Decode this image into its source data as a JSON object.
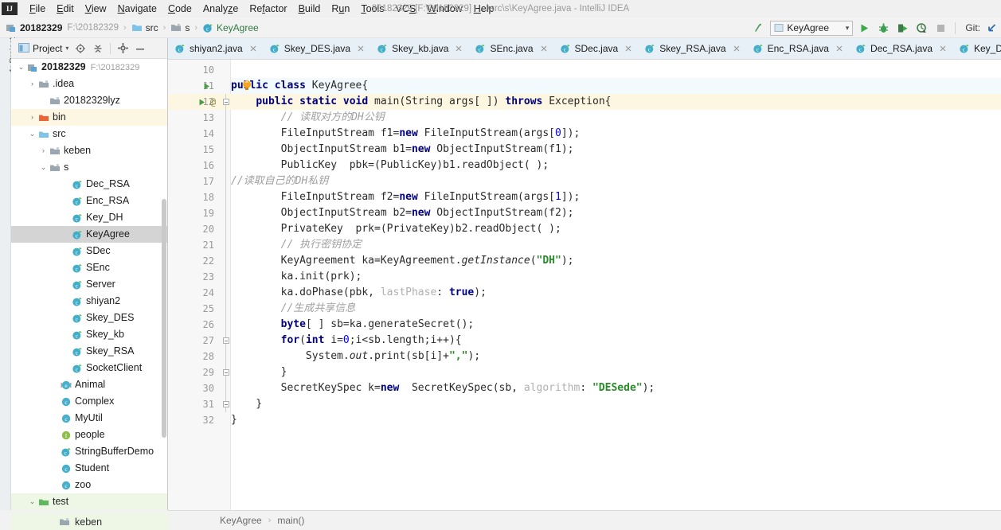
{
  "window": {
    "title": "20182329 [F:\\20182329] - ...\\src\\s\\KeyAgree.java - IntelliJ IDEA",
    "logo": "IJ"
  },
  "menu": {
    "items": [
      "File",
      "Edit",
      "View",
      "Navigate",
      "Code",
      "Analyze",
      "Refactor",
      "Build",
      "Run",
      "Tools",
      "VCS",
      "Window",
      "Help"
    ]
  },
  "breadcrumb": {
    "project": "20182329",
    "project_path": "F:\\20182329",
    "items": [
      "src",
      "s",
      "KeyAgree"
    ]
  },
  "toolbar": {
    "run_config": "KeyAgree",
    "git_label": "Git:",
    "icons": [
      "build-icon",
      "run-icon",
      "debug-icon",
      "run-coverage-icon",
      "profile-icon",
      "stop-icon",
      "vcs-update-icon"
    ]
  },
  "left_strip": {
    "tab_label": "1: Project"
  },
  "project_panel": {
    "title": "Project",
    "header_icons": [
      "locate-icon",
      "collapse-all-icon",
      "settings-icon",
      "hide-icon"
    ],
    "tree": [
      {
        "depth": 0,
        "arrow": "down",
        "icon": "module-icon",
        "label": "20182329",
        "path": "F:\\20182329",
        "bold": true,
        "style": "plain"
      },
      {
        "depth": 1,
        "arrow": "right",
        "icon": "folder-gray-icon",
        "label": ".idea",
        "style": "plain"
      },
      {
        "depth": 2,
        "arrow": "none",
        "icon": "folder-gray-icon",
        "label": "20182329lyz",
        "style": "plain"
      },
      {
        "depth": 1,
        "arrow": "right",
        "icon": "folder-orange-icon",
        "label": "bin",
        "style": "yellow"
      },
      {
        "depth": 1,
        "arrow": "down",
        "icon": "folder-blue-icon",
        "label": "src",
        "style": "plain"
      },
      {
        "depth": 2,
        "arrow": "right",
        "icon": "folder-gray-icon",
        "label": "keben",
        "style": "plain"
      },
      {
        "depth": 2,
        "arrow": "down",
        "icon": "folder-gray-icon",
        "label": "s",
        "style": "plain"
      },
      {
        "depth": 4,
        "arrow": "none",
        "icon": "java-class-runnable-icon",
        "label": "Dec_RSA",
        "style": "plain"
      },
      {
        "depth": 4,
        "arrow": "none",
        "icon": "java-class-runnable-icon",
        "label": "Enc_RSA",
        "style": "plain"
      },
      {
        "depth": 4,
        "arrow": "none",
        "icon": "java-class-runnable-icon",
        "label": "Key_DH",
        "style": "plain"
      },
      {
        "depth": 4,
        "arrow": "none",
        "icon": "java-class-runnable-icon",
        "label": "KeyAgree",
        "style": "selected"
      },
      {
        "depth": 4,
        "arrow": "none",
        "icon": "java-class-runnable-icon",
        "label": "SDec",
        "style": "plain"
      },
      {
        "depth": 4,
        "arrow": "none",
        "icon": "java-class-runnable-icon",
        "label": "SEnc",
        "style": "plain"
      },
      {
        "depth": 4,
        "arrow": "none",
        "icon": "java-class-runnable-icon",
        "label": "Server",
        "style": "plain"
      },
      {
        "depth": 4,
        "arrow": "none",
        "icon": "java-class-runnable-icon",
        "label": "shiyan2",
        "style": "plain"
      },
      {
        "depth": 4,
        "arrow": "none",
        "icon": "java-class-runnable-icon",
        "label": "Skey_DES",
        "style": "plain"
      },
      {
        "depth": 4,
        "arrow": "none",
        "icon": "java-class-runnable-icon",
        "label": "Skey_kb",
        "style": "plain"
      },
      {
        "depth": 4,
        "arrow": "none",
        "icon": "java-class-runnable-icon",
        "label": "Skey_RSA",
        "style": "plain"
      },
      {
        "depth": 4,
        "arrow": "none",
        "icon": "java-class-runnable-icon",
        "label": "SocketClient",
        "style": "plain"
      },
      {
        "depth": 3,
        "arrow": "none",
        "icon": "java-enum-icon",
        "label": "Animal",
        "style": "plain"
      },
      {
        "depth": 3,
        "arrow": "none",
        "icon": "java-class-icon",
        "label": "Complex",
        "style": "plain"
      },
      {
        "depth": 3,
        "arrow": "none",
        "icon": "java-class-icon",
        "label": "MyUtil",
        "style": "plain"
      },
      {
        "depth": 3,
        "arrow": "none",
        "icon": "java-interface-icon",
        "label": "people",
        "style": "plain"
      },
      {
        "depth": 3,
        "arrow": "none",
        "icon": "java-class-runnable-icon",
        "label": "StringBufferDemo",
        "style": "plain"
      },
      {
        "depth": 3,
        "arrow": "none",
        "icon": "java-class-icon",
        "label": "Student",
        "style": "plain"
      },
      {
        "depth": 3,
        "arrow": "none",
        "icon": "java-class-icon",
        "label": "zoo",
        "style": "plain"
      },
      {
        "depth": 1,
        "arrow": "down",
        "icon": "folder-green-icon",
        "label": "test",
        "style": "green"
      }
    ],
    "bottom_node": {
      "label": "keben",
      "icon": "folder-gray-icon"
    }
  },
  "editor_tabs": [
    {
      "label": "shiyan2.java",
      "icon": "java-class-runnable-icon",
      "active": false
    },
    {
      "label": "Skey_DES.java",
      "icon": "java-class-runnable-icon",
      "active": false
    },
    {
      "label": "Skey_kb.java",
      "icon": "java-class-runnable-icon",
      "active": false
    },
    {
      "label": "SEnc.java",
      "icon": "java-class-runnable-icon",
      "active": false
    },
    {
      "label": "SDec.java",
      "icon": "java-class-runnable-icon",
      "active": false
    },
    {
      "label": "Skey_RSA.java",
      "icon": "java-class-runnable-icon",
      "active": false
    },
    {
      "label": "Enc_RSA.java",
      "icon": "java-class-runnable-icon",
      "active": false
    },
    {
      "label": "Dec_RSA.java",
      "icon": "java-class-runnable-icon",
      "active": false
    },
    {
      "label": "Key_DH.java",
      "icon": "java-class-runnable-icon",
      "active": false
    }
  ],
  "editor": {
    "first_line": 10,
    "lines": [
      {
        "n": 10,
        "text": ""
      },
      {
        "n": 11,
        "text": "public class KeyAgree{"
      },
      {
        "n": 12,
        "text": "    public static void main(String args[ ]) throws Exception{"
      },
      {
        "n": 13,
        "text": "        // 读取对方的DH公钥"
      },
      {
        "n": 14,
        "text": "        FileInputStream f1=new FileInputStream(args[0]);"
      },
      {
        "n": 15,
        "text": "        ObjectInputStream b1=new ObjectInputStream(f1);"
      },
      {
        "n": 16,
        "text": "        PublicKey  pbk=(PublicKey)b1.readObject( );"
      },
      {
        "n": 17,
        "text": "//读取自己的DH私钥"
      },
      {
        "n": 18,
        "text": "        FileInputStream f2=new FileInputStream(args[1]);"
      },
      {
        "n": 19,
        "text": "        ObjectInputStream b2=new ObjectInputStream(f2);"
      },
      {
        "n": 20,
        "text": "        PrivateKey  prk=(PrivateKey)b2.readObject( );"
      },
      {
        "n": 21,
        "text": "        // 执行密钥协定"
      },
      {
        "n": 22,
        "text": "        KeyAgreement ka=KeyAgreement.getInstance(\"DH\");"
      },
      {
        "n": 23,
        "text": "        ka.init(prk);"
      },
      {
        "n": 24,
        "text": "        ka.doPhase(pbk, lastPhase: true);"
      },
      {
        "n": 25,
        "text": "        //生成共享信息"
      },
      {
        "n": 26,
        "text": "        byte[ ] sb=ka.generateSecret();"
      },
      {
        "n": 27,
        "text": "        for(int i=0;i<sb.length;i++){"
      },
      {
        "n": 28,
        "text": "            System.out.print(sb[i]+\",\");"
      },
      {
        "n": 29,
        "text": "        }"
      },
      {
        "n": 30,
        "text": "        SecretKeySpec k=new  SecretKeySpec(sb, algorithm: \"DESede\");"
      },
      {
        "n": 31,
        "text": "    }"
      },
      {
        "n": 32,
        "text": "}"
      }
    ],
    "gutter_markers": [
      {
        "line": 11,
        "marker": "run-gutter-icon"
      },
      {
        "line": 11,
        "marker": "intention-bulb-icon"
      },
      {
        "line": 12,
        "marker": "run-gutter-icon"
      },
      {
        "line": 12,
        "marker": "override-at-icon"
      }
    ],
    "caret_line": 12,
    "selection": "Exception{"
  },
  "statusbar": {
    "crumbs": [
      "KeyAgree",
      "main()"
    ]
  },
  "colors": {
    "keyword": "#000080",
    "string": "#2a8c2a",
    "comment": "#a0a0a0",
    "number": "#0000ff",
    "accent_green": "#4a9c4a",
    "selection": "#a6d2ff",
    "caret_row": "#fdf6e0"
  }
}
